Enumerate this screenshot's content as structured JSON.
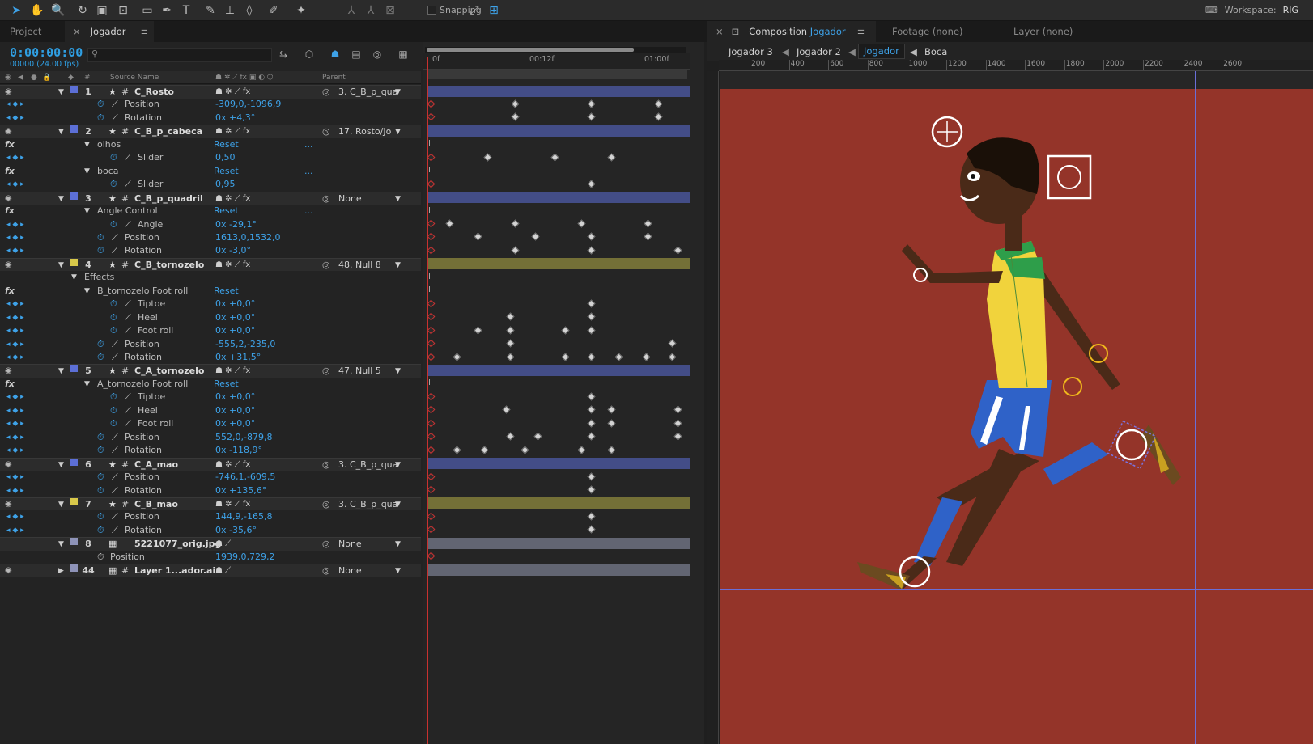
{
  "toolbar": {
    "snapping_label": "Snapping",
    "workspace_label": "Workspace:",
    "workspace_value": "RIG"
  },
  "left_tabs": {
    "project": "Project",
    "timeline": "Jogador",
    "menu_icon": "hamburger-icon"
  },
  "timecode": "0:00:00:00",
  "fps_text": "00000 (24.00 fps)",
  "search_placeholder": "",
  "columns": {
    "hash": "#",
    "source_name": "Source Name",
    "parent": "Parent"
  },
  "timeline_ruler": {
    "t0": "0f",
    "t1": "00:12f",
    "t2": "01:00f"
  },
  "layers": [
    {
      "num": "1",
      "name": "C_Rosto",
      "color": "#5c6fd6",
      "parent": "3. C_B_p_qua"
    },
    {
      "num": "2",
      "name": "C_B_p_cabeca",
      "color": "#5c6fd6",
      "parent": "17. Rosto/Jo"
    },
    {
      "num": "3",
      "name": "C_B_p_quadril",
      "color": "#5c6fd6",
      "parent": "None"
    },
    {
      "num": "4",
      "name": "C_B_tornozelo",
      "color": "#d8c84a",
      "parent": "48. Null 8"
    },
    {
      "num": "5",
      "name": "C_A_tornozelo",
      "color": "#5c6fd6",
      "parent": "47. Null 5"
    },
    {
      "num": "6",
      "name": "C_A_mao",
      "color": "#5c6fd6",
      "parent": "3. C_B_p_qua"
    },
    {
      "num": "7",
      "name": "C_B_mao",
      "color": "#d8c84a",
      "parent": "3. C_B_p_qua"
    },
    {
      "num": "8",
      "name": "5221077_orig.jpg",
      "color": "#8e93b8",
      "parent": "None"
    },
    {
      "num": "44",
      "name": "Layer 1...ador.ai",
      "color": "#8e93b8",
      "parent": "None"
    }
  ],
  "props": {
    "l1_pos": {
      "label": "Position",
      "value": "-309,0,-1096,9"
    },
    "l1_rot": {
      "label": "Rotation",
      "value": "0x +4,3°"
    },
    "l2_olhos": {
      "label": "olhos",
      "value": "Reset"
    },
    "l2_olhos_slider": {
      "label": "Slider",
      "value": "0,50"
    },
    "l2_boca": {
      "label": "boca",
      "value": "Reset"
    },
    "l2_boca_slider": {
      "label": "Slider",
      "value": "0,95"
    },
    "l3_angle_ctrl": {
      "label": "Angle Control",
      "value": "Reset"
    },
    "l3_angle": {
      "label": "Angle",
      "value": "0x -29,1°"
    },
    "l3_pos": {
      "label": "Position",
      "value": "1613,0,1532,0"
    },
    "l3_rot": {
      "label": "Rotation",
      "value": "0x -3,0°"
    },
    "l4_effects": {
      "label": "Effects"
    },
    "l4_footroll": {
      "label": "B_tornozelo Foot roll",
      "value": "Reset"
    },
    "l4_tiptoe": {
      "label": "Tiptoe",
      "value": "0x +0,0°"
    },
    "l4_heel": {
      "label": "Heel",
      "value": "0x +0,0°"
    },
    "l4_foot": {
      "label": "Foot roll",
      "value": "0x +0,0°"
    },
    "l4_pos": {
      "label": "Position",
      "value": "-555,2,-235,0"
    },
    "l4_rot": {
      "label": "Rotation",
      "value": "0x +31,5°"
    },
    "l5_footroll": {
      "label": "A_tornozelo Foot roll",
      "value": "Reset"
    },
    "l5_tiptoe": {
      "label": "Tiptoe",
      "value": "0x +0,0°"
    },
    "l5_heel": {
      "label": "Heel",
      "value": "0x +0,0°"
    },
    "l5_foot": {
      "label": "Foot roll",
      "value": "0x +0,0°"
    },
    "l5_pos": {
      "label": "Position",
      "value": "552,0,-879,8"
    },
    "l5_rot": {
      "label": "Rotation",
      "value": "0x -118,9°"
    },
    "l6_pos": {
      "label": "Position",
      "value": "-746,1,-609,5"
    },
    "l6_rot": {
      "label": "Rotation",
      "value": "0x +135,6°"
    },
    "l7_pos": {
      "label": "Position",
      "value": "144,9,-165,8"
    },
    "l7_rot": {
      "label": "Rotation",
      "value": "0x -35,6°"
    },
    "l8_pos": {
      "label": "Position",
      "value": "1939,0,729,2"
    }
  },
  "comp": {
    "tab_label": "Composition",
    "tab_name": "Jogador",
    "footage": "Footage (none)",
    "layer": "Layer (none)"
  },
  "flow": [
    "Jogador 3",
    "Jogador 2",
    "Jogador",
    "Boca"
  ],
  "ruler_labels": [
    "200",
    "400",
    "600",
    "800",
    "1000",
    "1200",
    "1400",
    "1600",
    "1800",
    "2000",
    "2200",
    "2400",
    "2600"
  ]
}
